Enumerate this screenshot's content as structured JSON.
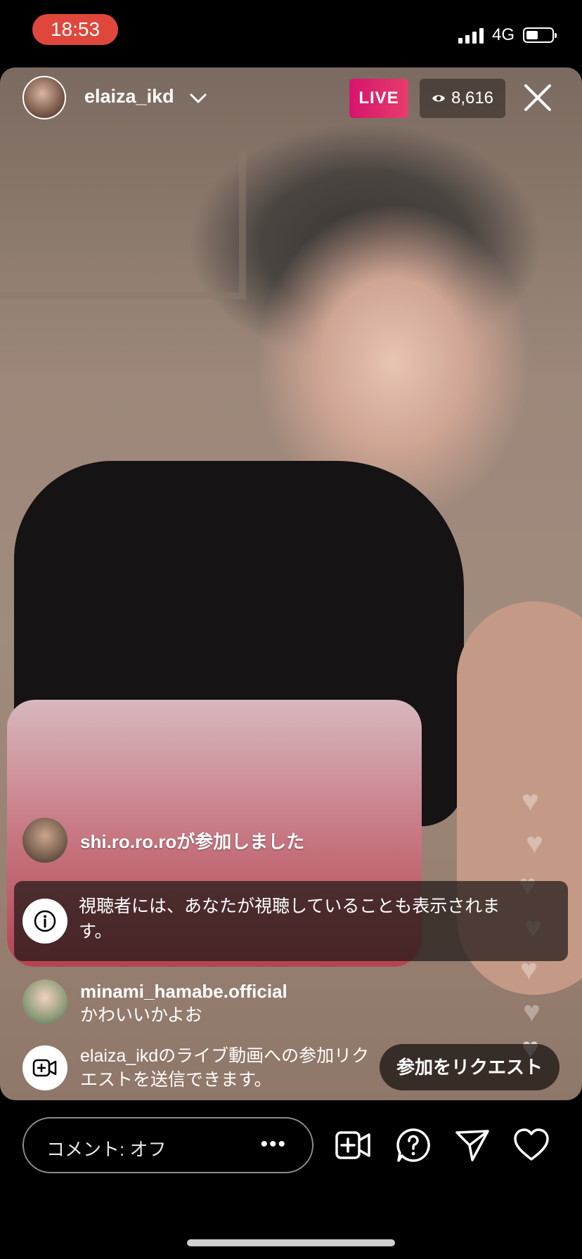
{
  "status_bar": {
    "time": "18:53",
    "network": "4G"
  },
  "header": {
    "username": "elaiza_ikd",
    "live_label": "LIVE",
    "viewer_count": "8,616"
  },
  "comments": [
    {
      "type": "join",
      "text": "shi.ro.ro.roが参加しました"
    },
    {
      "type": "info",
      "text": "視聴者には、あなたが視聴していることも表示されます。"
    },
    {
      "type": "comment",
      "username": "minami_hamabe.official",
      "text": "かわいいかよお"
    }
  ],
  "request": {
    "text": "elaiza_ikdのライブ動画への参加リクエストを送信できます。",
    "button_label": "参加をリクエスト"
  },
  "bottom_bar": {
    "comment_placeholder": "コメント: オフ",
    "more_label": "•••"
  },
  "icons": [
    "info-icon",
    "video-add-icon",
    "question-icon",
    "send-icon",
    "heart-icon",
    "eye-icon",
    "close-icon",
    "chevron-down-icon"
  ],
  "colors": {
    "live_badge": "#d7136e",
    "status_time_bg": "#e0473c"
  }
}
